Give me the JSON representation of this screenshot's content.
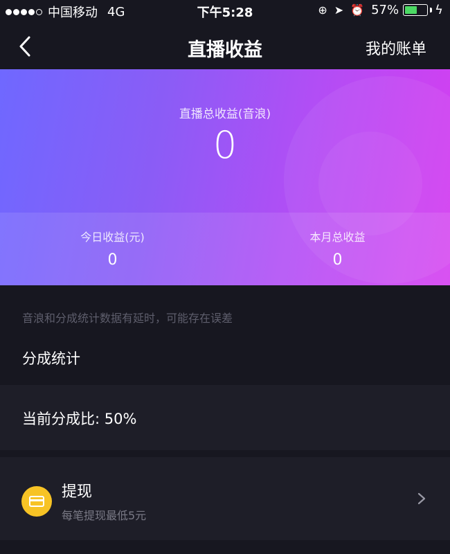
{
  "status_bar": {
    "carrier": "中国移动",
    "network": "4G",
    "time": "下午5:28",
    "battery_percent": "57%",
    "battery_level": 0.57,
    "battery_color": "#4cd964"
  },
  "nav": {
    "back_icon": "chevron-left-icon",
    "title": "直播收益",
    "right_link": "我的账单"
  },
  "earnings": {
    "total_label": "直播总收益(音浪)",
    "total_value": "0",
    "today_label": "今日收益(元)",
    "today_value": "0",
    "month_label": "本月总收益",
    "month_value": "0",
    "gradient_colors": [
      "#6f68ff",
      "#8b5cf6",
      "#b14ef5",
      "#d53ef1"
    ]
  },
  "notice": "音浪和分成统计数据有延时，可能存在误差",
  "split": {
    "section_title": "分成统计",
    "ratio_text": "当前分成比: 50%"
  },
  "withdraw": {
    "icon": "wallet-icon",
    "icon_color": "#f7c325",
    "title": "提现",
    "subtitle": "每笔提现最低5元",
    "chevron_icon": "chevron-right-icon"
  }
}
